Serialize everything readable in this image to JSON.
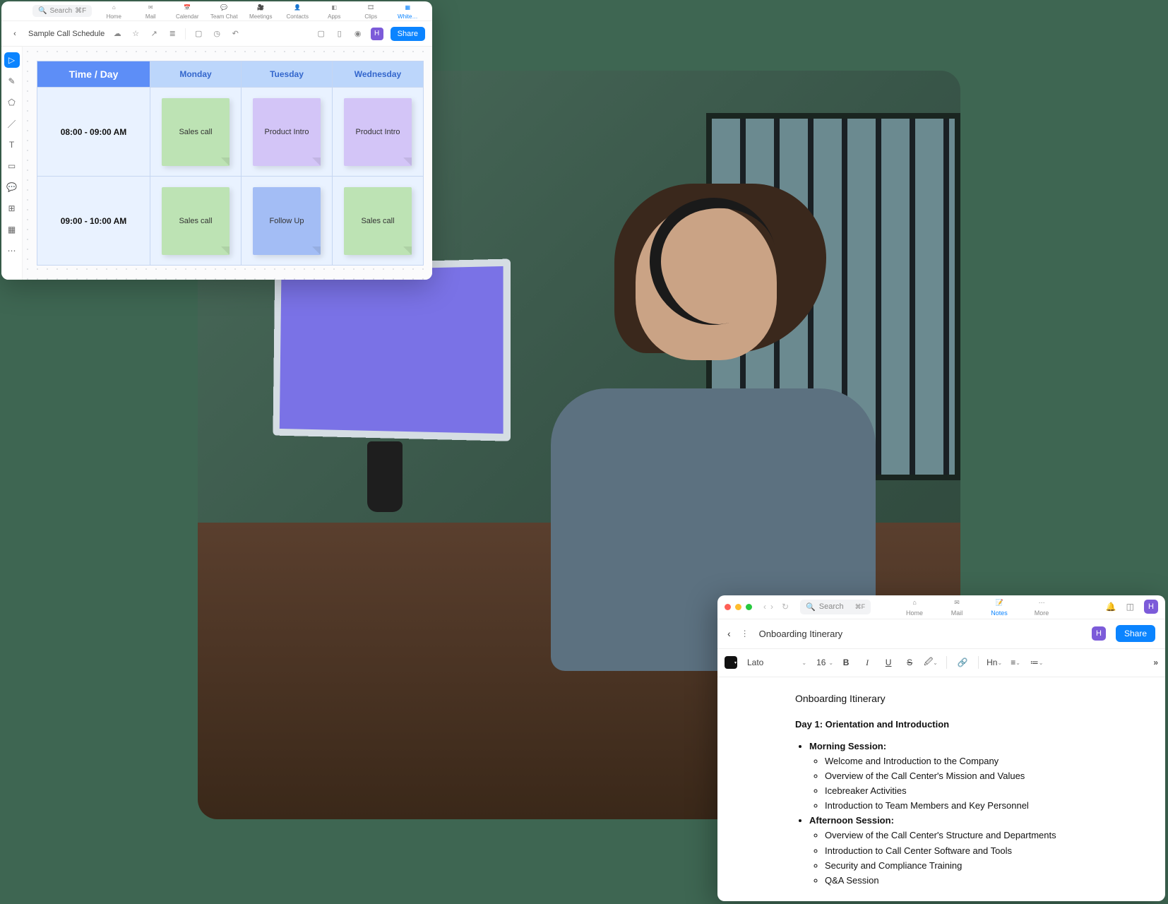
{
  "whiteboard": {
    "search_placeholder": "Search",
    "search_shortcut": "⌘F",
    "nav": [
      {
        "id": "home",
        "label": "Home"
      },
      {
        "id": "mail",
        "label": "Mail"
      },
      {
        "id": "calendar",
        "label": "Calendar"
      },
      {
        "id": "teamchat",
        "label": "Team Chat"
      },
      {
        "id": "meetings",
        "label": "Meetings"
      },
      {
        "id": "contacts",
        "label": "Contacts"
      },
      {
        "id": "apps",
        "label": "Apps"
      },
      {
        "id": "clips",
        "label": "Clips"
      },
      {
        "id": "white",
        "label": "White…"
      }
    ],
    "nav_active": "white",
    "doc_title": "Sample Call Schedule",
    "avatar_initial": "H",
    "share_label": "Share",
    "tools": [
      {
        "id": "select",
        "icon": "▷"
      },
      {
        "id": "pen",
        "icon": "✎"
      },
      {
        "id": "shapes",
        "icon": "⬠"
      },
      {
        "id": "line",
        "icon": "／"
      },
      {
        "id": "text",
        "icon": "T"
      },
      {
        "id": "sticky",
        "icon": "▭"
      },
      {
        "id": "comment",
        "icon": "💬"
      },
      {
        "id": "frame",
        "icon": "⊞"
      },
      {
        "id": "image",
        "icon": "▦"
      },
      {
        "id": "more",
        "icon": "⋯"
      }
    ],
    "active_tool": "select",
    "schedule": {
      "header_time_day": "Time / Day",
      "days": [
        "Monday",
        "Tuesday",
        "Wednesday"
      ],
      "rows": [
        {
          "time": "08:00 - 09:00 AM",
          "cells": [
            {
              "text": "Sales call",
              "color": "green"
            },
            {
              "text": "Product Intro",
              "color": "purple"
            },
            {
              "text": "Product Intro",
              "color": "purple"
            }
          ]
        },
        {
          "time": "09:00 - 10:00 AM",
          "cells": [
            {
              "text": "Sales call",
              "color": "green"
            },
            {
              "text": "Follow Up",
              "color": "blue"
            },
            {
              "text": "Sales call",
              "color": "green"
            }
          ]
        }
      ]
    }
  },
  "notes": {
    "search_placeholder": "Search",
    "search_shortcut": "⌘F",
    "nav": [
      {
        "id": "home",
        "label": "Home"
      },
      {
        "id": "mail",
        "label": "Mail"
      },
      {
        "id": "notes",
        "label": "Notes"
      },
      {
        "id": "more",
        "label": "More"
      }
    ],
    "nav_active": "notes",
    "doc_title": "Onboarding Itinerary",
    "avatar_initial": "H",
    "share_label": "Share",
    "toolbar": {
      "font_name": "Lato",
      "font_size": "16",
      "heading_label": "Hn"
    },
    "content": {
      "title": "Onboarding Itinerary",
      "day_heading": "Day 1: Orientation and Introduction",
      "sessions": [
        {
          "name": "Morning Session:",
          "items": [
            "Welcome and Introduction to the Company",
            "Overview of the Call Center's Mission and Values",
            "Icebreaker Activities",
            "Introduction to Team Members and Key Personnel"
          ]
        },
        {
          "name": "Afternoon Session:",
          "items": [
            "Overview of the Call Center's Structure and Departments",
            "Introduction to Call Center Software and Tools",
            "Security and Compliance Training",
            "Q&A Session"
          ]
        }
      ]
    }
  }
}
